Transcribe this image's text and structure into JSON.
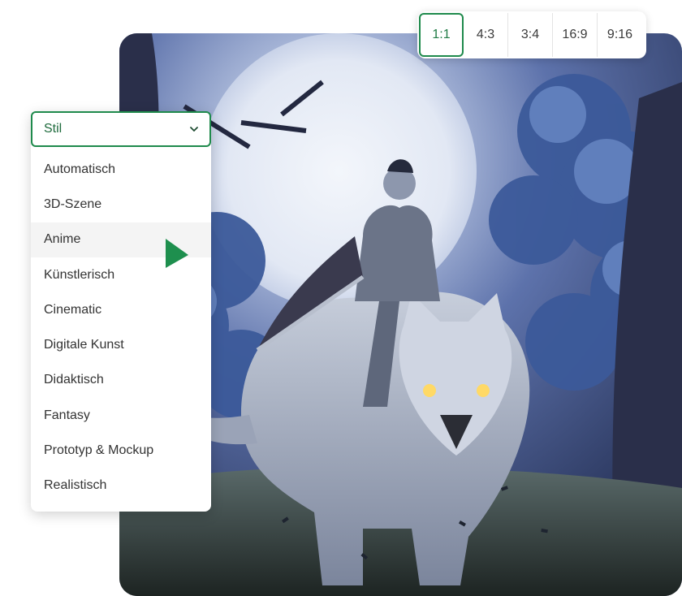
{
  "aspect_ratios": {
    "options": [
      "1:1",
      "4:3",
      "3:4",
      "16:9",
      "9:16"
    ],
    "selected": "1:1"
  },
  "style_dropdown": {
    "label": "Stil",
    "options": [
      "Automatisch",
      "3D-Szene",
      "Anime",
      "Künstlerisch",
      "Cinematic",
      "Digitale Kunst",
      "Didaktisch",
      "Fantasy",
      "Prototyp & Mockup",
      "Realistisch"
    ],
    "hovered": "Anime"
  },
  "colors": {
    "accent": "#1f8a4c",
    "cursor": "#1e8f4e"
  },
  "icons": {
    "dropdown": "chevron-down-icon",
    "pointer": "cursor-arrow-icon"
  }
}
